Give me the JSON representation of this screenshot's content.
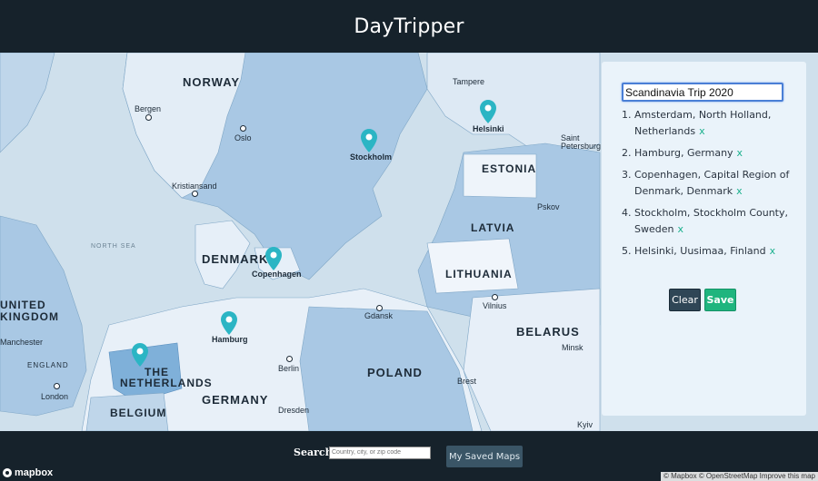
{
  "header": {
    "title": "DayTripper"
  },
  "map": {
    "country_labels": [
      "NORWAY",
      "ESTONIA",
      "LATVIA",
      "LITHUANIA",
      "DENMARK",
      "THE",
      "NETHERLANDS",
      "BELGIUM",
      "GERMANY",
      "POLAND",
      "BELARUS",
      "UNITED",
      "KINGDOM",
      "ENGLAND"
    ],
    "city_labels": [
      "Bergen",
      "Oslo",
      "Kristiansand",
      "Stockholm",
      "Helsinki",
      "Tampere",
      "Saint",
      "Petersburg",
      "Pskov",
      "Copenhagen",
      "Hamburg",
      "Berlin",
      "Gdansk",
      "Vilnius",
      "Minsk",
      "Brest",
      "Dresden",
      "Kyiv",
      "London",
      "Manchester"
    ],
    "sea_labels": [
      "NORTH SEA"
    ],
    "marker_cities": [
      "Stockholm",
      "Helsinki",
      "Copenhagen",
      "Hamburg",
      "Amsterdam"
    ],
    "colors": {
      "water": "#cfe0ec",
      "land_light": "#e8f0f8",
      "land_mid": "#a9c8e4",
      "land_dark": "#7fb0d9",
      "marker": "#2bb5c4"
    }
  },
  "panel": {
    "trip_name": "Scandinavia Trip 2020",
    "stops": [
      {
        "num": "1.",
        "name": "Amsterdam, North Holland, Netherlands"
      },
      {
        "num": "2.",
        "name": "Hamburg, Germany"
      },
      {
        "num": "3.",
        "name": "Copenhagen, Capital Region of Denmark, Denmark"
      },
      {
        "num": "4.",
        "name": "Stockholm, Stockholm County, Sweden"
      },
      {
        "num": "5.",
        "name": "Helsinki, Uusimaa, Finland"
      }
    ],
    "remove_glyph": "x",
    "clear_label": "Clear",
    "save_label": "Save"
  },
  "footer": {
    "search_label": "Search",
    "search_placeholder": "Country, city, or zip code",
    "saved_maps_label": "My Saved Maps",
    "logo_text": "mapbox",
    "attribution": "© Mapbox © OpenStreetMap  Improve this map"
  }
}
